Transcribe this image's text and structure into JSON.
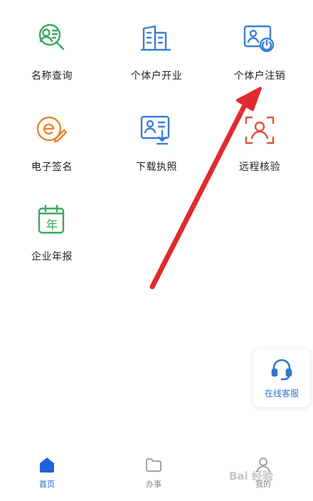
{
  "grid": {
    "items": [
      {
        "label": "名称查询",
        "icon": "name-search-icon",
        "color": "#3aa860"
      },
      {
        "label": "个体户开业",
        "icon": "building-icon",
        "color": "#3b7fd4"
      },
      {
        "label": "个体户注销",
        "icon": "person-power-icon",
        "color": "#3b7fd4"
      },
      {
        "label": "电子签名",
        "icon": "e-signature-icon",
        "color": "#e8862a"
      },
      {
        "label": "下载执照",
        "icon": "license-download-icon",
        "color": "#3b7fd4"
      },
      {
        "label": "远程核验",
        "icon": "face-verify-icon",
        "color": "#e0533c"
      },
      {
        "label": "企业年报",
        "icon": "calendar-year-icon",
        "color": "#3aa860"
      }
    ],
    "calendar_glyph": "年"
  },
  "service": {
    "label": "在线客服",
    "color": "#2f78c8"
  },
  "tabs": [
    {
      "label": "首页",
      "active": true
    },
    {
      "label": "办事",
      "active": false
    },
    {
      "label": "我的",
      "active": false
    }
  ],
  "annotation": {
    "color": "#e02b2f"
  },
  "watermark": "Bai 经验"
}
